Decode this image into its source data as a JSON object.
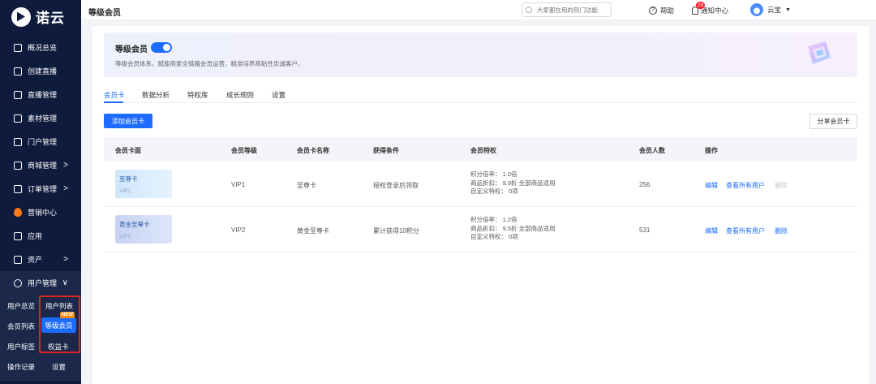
{
  "app": {
    "logo_text": "诺云"
  },
  "sidebar": {
    "items": [
      {
        "label": "概况总览",
        "icon": "overview-icon"
      },
      {
        "label": "创建直播",
        "icon": "plus-square-icon"
      },
      {
        "label": "直播管理",
        "icon": "live-icon"
      },
      {
        "label": "素材管理",
        "icon": "folder-icon"
      },
      {
        "label": "门户管理",
        "icon": "home-icon"
      },
      {
        "label": "商城管理",
        "icon": "shop-icon",
        "arrow": ">"
      },
      {
        "label": "订单管理",
        "icon": "order-icon",
        "arrow": ">"
      },
      {
        "label": "营销中心",
        "icon": "fire-icon"
      },
      {
        "label": "应用",
        "icon": "apps-icon"
      },
      {
        "label": "资产",
        "icon": "asset-icon",
        "arrow": ">"
      },
      {
        "label": "用户管理",
        "icon": "user-icon",
        "arrow": "∨"
      }
    ],
    "submenu": {
      "user_overview": "用户总览",
      "user_list": "用户列表",
      "member_list": "会员列表",
      "level_member": "等级会员",
      "new_badge": "NEW",
      "user_tags": "用户标签",
      "benefit_card": "权益卡",
      "operation_log": "操作记录",
      "settings": "设置"
    }
  },
  "header": {
    "title": "等级会员",
    "search_placeholder": "大家都在用的热门功能",
    "help": "帮助",
    "notify": "通知中心",
    "notify_count": "29",
    "username": "云宝",
    "dropdown": "▼"
  },
  "banner": {
    "title": "等级会员",
    "enabled": true,
    "description": "等级会员体系，赋能商家全链路会员运营，精准培养高粘性忠诚客户。"
  },
  "tabs": [
    "会员卡",
    "数据分析",
    "特权库",
    "成长规则",
    "设置"
  ],
  "actions": {
    "add_card": "添加会员卡",
    "share_card": "分享会员卡"
  },
  "table": {
    "columns": [
      "会员卡面",
      "会员等级",
      "会员卡名称",
      "获得条件",
      "会员特权",
      "会员人数",
      "操作"
    ],
    "rows": [
      {
        "card_name": "至尊卡",
        "card_level": "VIP1",
        "level": "VIP1",
        "name": "至尊卡",
        "condition": "授权登录后领取",
        "perk_points": "积分倍率：  1.0倍",
        "perk_discount": "商品折扣：  9.9折 全部商品适用",
        "perk_custom": "自定义特权：  0项",
        "count": "256",
        "op_edit": "编辑",
        "op_view": "查看所有用户",
        "op_delete": "删除",
        "delete_disabled": true
      },
      {
        "card_name": "黄金至尊卡",
        "card_level": "VIP2",
        "level": "VIP2",
        "name": "黄金至尊卡",
        "condition": "累计获得10积分",
        "perk_points": "积分倍率：  1.2倍",
        "perk_discount": "商品折扣：  9.5折 全部商品适用",
        "perk_custom": "自定义特权：  0项",
        "count": "531",
        "op_edit": "编辑",
        "op_view": "查看所有用户",
        "op_delete": "删除",
        "delete_disabled": false
      }
    ]
  }
}
